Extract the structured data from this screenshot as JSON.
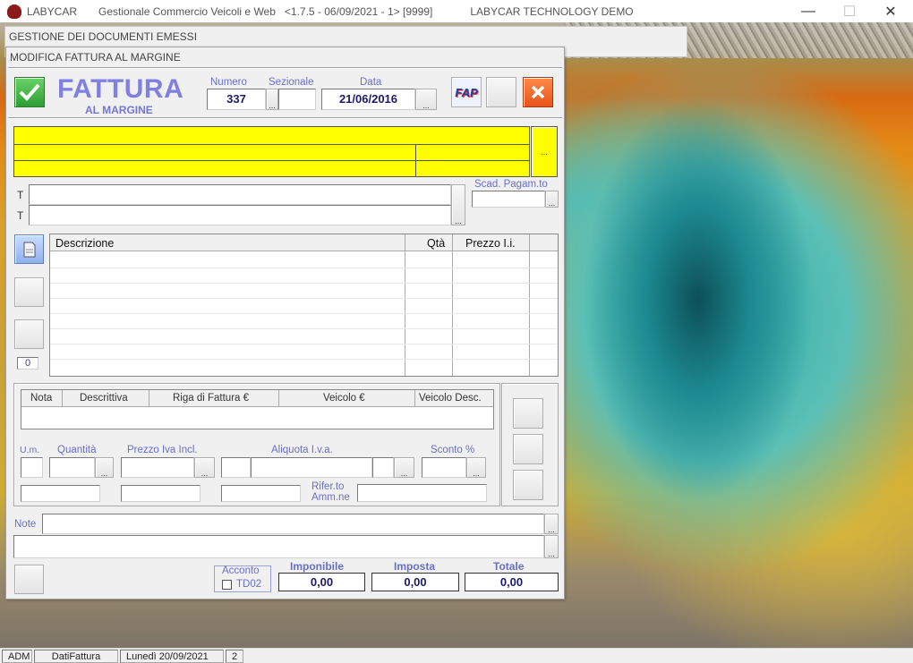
{
  "titlebar": {
    "app_name": "LABYCAR",
    "app_desc": "Gestionale Commercio Veicoli e Web   <1.7.5 - 06/09/2021 - 1> [9999]",
    "company": "LABYCAR TECHNOLOGY DEMO",
    "min": "—",
    "max": "☐",
    "close": "✕"
  },
  "back_window": {
    "caption": "GESTIONE DEI DOCUMENTI EMESSI"
  },
  "main_window": {
    "caption": "MODIFICA FATTURA AL MARGINE",
    "title": "FATTURA",
    "subtitle": "AL MARGINE",
    "numero_label": "Numero",
    "numero_value": "337",
    "sezionale_label": "Sezionale",
    "sezionale_value": "",
    "data_label": "Data",
    "data_value": "21/06/2016",
    "dots": "...",
    "fap_logo": "FAP",
    "t_label": "T",
    "scad_label": "Scad. Pagam.to",
    "doc_counter": "0"
  },
  "grid": {
    "columns": [
      "Descrizione",
      "Qtà",
      "Prezzo I.i."
    ]
  },
  "detail": {
    "columns": [
      "Nota",
      "Descrittiva",
      "Riga di Fattura €",
      "Veicolo €",
      "Veicolo Desc."
    ],
    "um_label": "U.m.",
    "quantita_label": "Quantità",
    "prezzo_label": "Prezzo Iva Incl.",
    "aliquota_label": "Aliquota I.v.a.",
    "sconto_label": "Sconto %",
    "rifer_label_1": "Rifer.to",
    "rifer_label_2": "Amm.ne"
  },
  "note": {
    "label": "Note"
  },
  "footer": {
    "acconto_label": "Acconto",
    "td02_label": "TD02",
    "imponibile_label": "Imponibile",
    "imponibile_value": "0,00",
    "imposta_label": "Imposta",
    "imposta_value": "0,00",
    "totale_label": "Totale",
    "totale_value": "0,00"
  },
  "statusbar": {
    "user": "ADM",
    "module": "DatiFattura",
    "date": "Lunedì 20/09/2021",
    "num": "2"
  },
  "colors": {
    "accent_label": "#6a6fc6",
    "title_purple": "#8080e0",
    "highlight_yellow": "#ffff00",
    "ok_green": "#3cb043",
    "cancel_orange": "#f0641e"
  }
}
